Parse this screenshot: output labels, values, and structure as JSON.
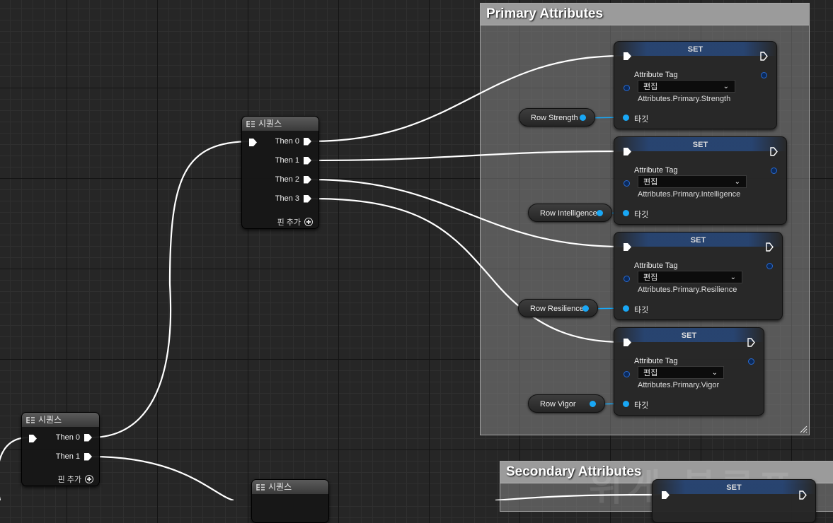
{
  "comments": {
    "primary": {
      "title": "Primary Attributes"
    },
    "secondary": {
      "title": "Secondary Attributes"
    }
  },
  "watermark": "위게 블루프",
  "sequence_nodes": {
    "title": "시퀀스",
    "then0": "Then 0",
    "then1": "Then 1",
    "then2": "Then 2",
    "then3": "Then 3",
    "add_pin": "핀 추가"
  },
  "set_nodes": {
    "header": "SET",
    "attribute_tag_label": "Attribute Tag",
    "edit_label": "편집",
    "target_label": "타깃",
    "tags": {
      "strength": "Attributes.Primary.Strength",
      "intelligence": "Attributes.Primary.Intelligence",
      "resilience": "Attributes.Primary.Resilience",
      "vigor": "Attributes.Primary.Vigor"
    }
  },
  "variables": {
    "strength": "Row Strength",
    "intelligence": "Row Intelligence",
    "resilience": "Row Resilience",
    "vigor": "Row Vigor"
  },
  "colors": {
    "background": "#262626",
    "exec_wire": "#ffffff",
    "object_pin": "#19a7f5",
    "set_header_blue": "#285aaa"
  },
  "icons": [
    "sequence-icon",
    "exec-pin-icon",
    "add-pin-icon",
    "object-pin-icon",
    "chevron-down-icon",
    "resize-grip-icon"
  ]
}
